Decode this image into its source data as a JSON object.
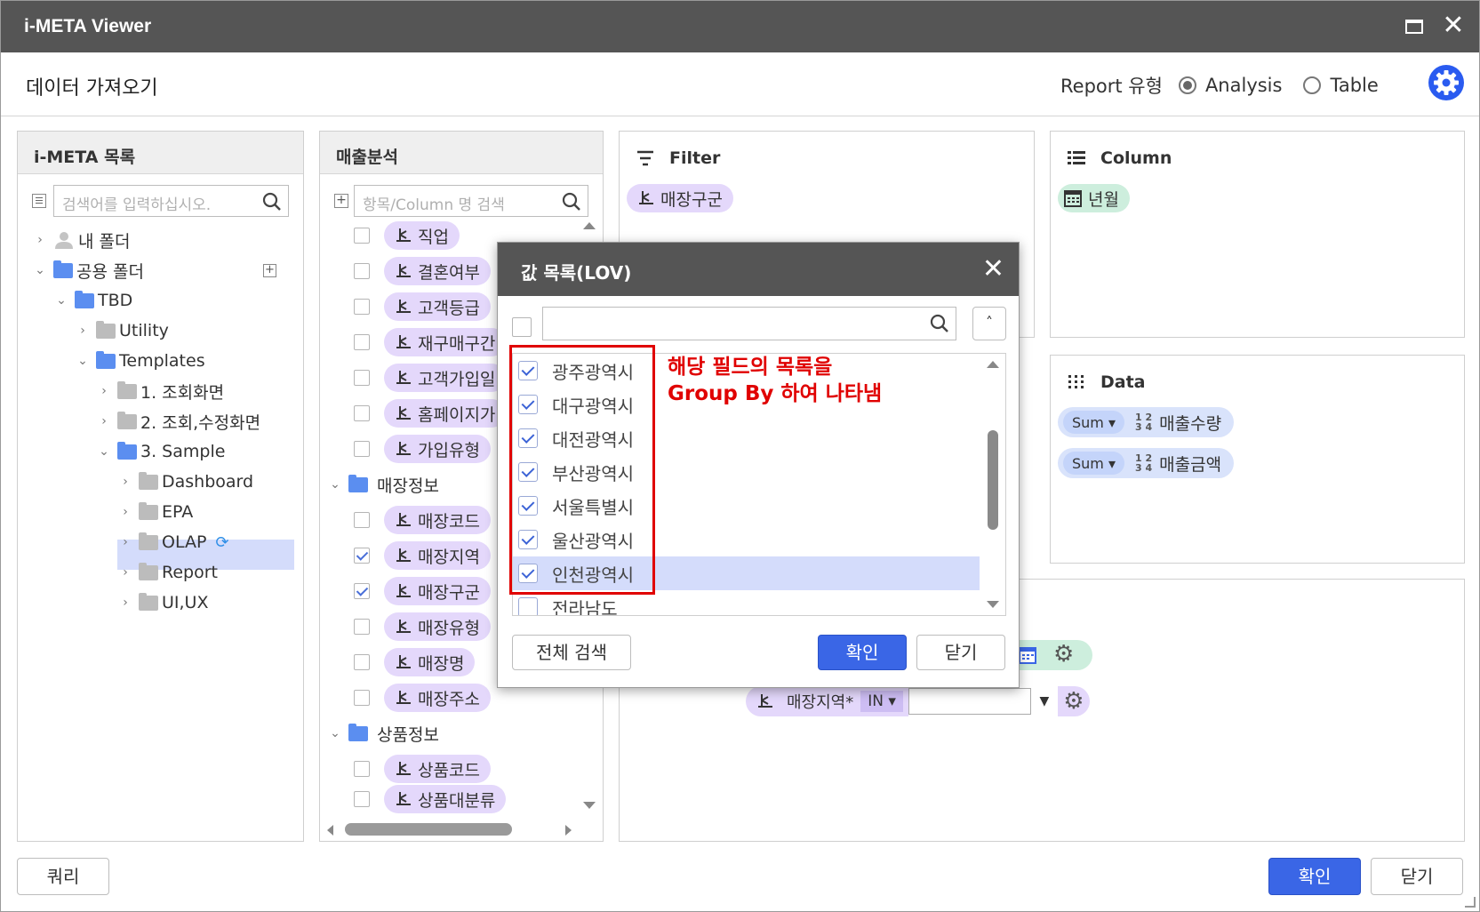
{
  "window": {
    "title": "i-META Viewer"
  },
  "header": {
    "title": "데이터 가져오기",
    "report_type_label": "Report 유형",
    "options": [
      {
        "label": "Analysis",
        "selected": true
      },
      {
        "label": "Table",
        "selected": false
      }
    ]
  },
  "meta_panel": {
    "title": "i-META 목록",
    "search_placeholder": "검색어를 입력하십시오.",
    "tree": [
      {
        "label": "내 폴더",
        "level": 0,
        "expanded": false,
        "icon": "user-folder-icon"
      },
      {
        "label": "공용 폴더",
        "level": 0,
        "expanded": true,
        "icon": "folder-icon"
      },
      {
        "label": "TBD",
        "level": 1,
        "expanded": true,
        "icon": "folder-icon"
      },
      {
        "label": "Utility",
        "level": 2,
        "expanded": false,
        "icon": "folder-icon"
      },
      {
        "label": "Templates",
        "level": 2,
        "expanded": true,
        "icon": "folder-icon"
      },
      {
        "label": "1. 조회화면",
        "level": 3,
        "expanded": false,
        "icon": "folder-icon"
      },
      {
        "label": "2. 조회,수정화면",
        "level": 3,
        "expanded": false,
        "icon": "folder-icon"
      },
      {
        "label": "3. Sample",
        "level": 3,
        "expanded": true,
        "icon": "folder-icon"
      },
      {
        "label": "Dashboard",
        "level": 4,
        "expanded": false,
        "icon": "folder-icon"
      },
      {
        "label": "EPA",
        "level": 4,
        "expanded": false,
        "icon": "folder-icon"
      },
      {
        "label": "OLAP",
        "level": 4,
        "expanded": false,
        "icon": "folder-icon",
        "selected": true
      },
      {
        "label": "Report",
        "level": 4,
        "expanded": false,
        "icon": "folder-icon"
      },
      {
        "label": "UI,UX",
        "level": 4,
        "expanded": false,
        "icon": "folder-icon"
      }
    ]
  },
  "fields_panel": {
    "title": "매출분석",
    "search_placeholder": "항목/Column 명 검색",
    "items": [
      {
        "type": "field",
        "label": "직업",
        "checked": false
      },
      {
        "type": "field",
        "label": "결혼여부",
        "checked": false
      },
      {
        "type": "field",
        "label": "고객등급",
        "checked": false
      },
      {
        "type": "field",
        "label": "재구매구간",
        "checked": false
      },
      {
        "type": "field",
        "label": "고객가입일",
        "checked": false
      },
      {
        "type": "field",
        "label": "홈페이지가",
        "checked": false
      },
      {
        "type": "field",
        "label": "가입유형",
        "checked": false
      },
      {
        "type": "group",
        "label": "매장정보"
      },
      {
        "type": "field",
        "label": "매장코드",
        "checked": false
      },
      {
        "type": "field",
        "label": "매장지역",
        "checked": true
      },
      {
        "type": "field",
        "label": "매장구군",
        "checked": true
      },
      {
        "type": "field",
        "label": "매장유형",
        "checked": false
      },
      {
        "type": "field",
        "label": "매장명",
        "checked": false
      },
      {
        "type": "field",
        "label": "매장주소",
        "checked": false
      },
      {
        "type": "group",
        "label": "상품정보"
      },
      {
        "type": "field",
        "label": "상품코드",
        "checked": false
      },
      {
        "type": "field",
        "label": "상품대분류",
        "checked": false
      }
    ]
  },
  "filter_panel": {
    "title": "Filter",
    "items": [
      "매장구군"
    ]
  },
  "column_panel": {
    "title": "Column",
    "items": [
      "년월"
    ]
  },
  "data_panel": {
    "title": "Data",
    "items": [
      {
        "agg": "Sum",
        "label": "매출수량"
      },
      {
        "agg": "Sum",
        "label": "매출금액"
      }
    ]
  },
  "condition": {
    "field": "매장지역*",
    "operator": "IN",
    "value": ""
  },
  "lov_dialog": {
    "title": "값 목록(LOV)",
    "search_value": "",
    "items": [
      {
        "label": "광주광역시",
        "checked": true
      },
      {
        "label": "대구광역시",
        "checked": true
      },
      {
        "label": "대전광역시",
        "checked": true
      },
      {
        "label": "부산광역시",
        "checked": true
      },
      {
        "label": "서울특별시",
        "checked": true
      },
      {
        "label": "울산광역시",
        "checked": true
      },
      {
        "label": "인천광역시",
        "checked": true,
        "selected": true
      },
      {
        "label": "전라남도",
        "checked": false
      }
    ],
    "search_all_label": "전체 검색",
    "ok_label": "확인",
    "close_label": "닫기"
  },
  "annotation": {
    "line1": "해당 필드의 목록을",
    "line2": "Group By 하여 나타냄"
  },
  "footer": {
    "query_label": "쿼리",
    "ok_label": "확인",
    "close_label": "닫기"
  },
  "colors": {
    "titlebar": "#555555",
    "accent_blue": "#3a66e6",
    "dimension_pill": "#e4d8fb",
    "column_pill": "#cdeedd",
    "data_pill": "#d9e3fb",
    "annotation": "#e00000"
  }
}
